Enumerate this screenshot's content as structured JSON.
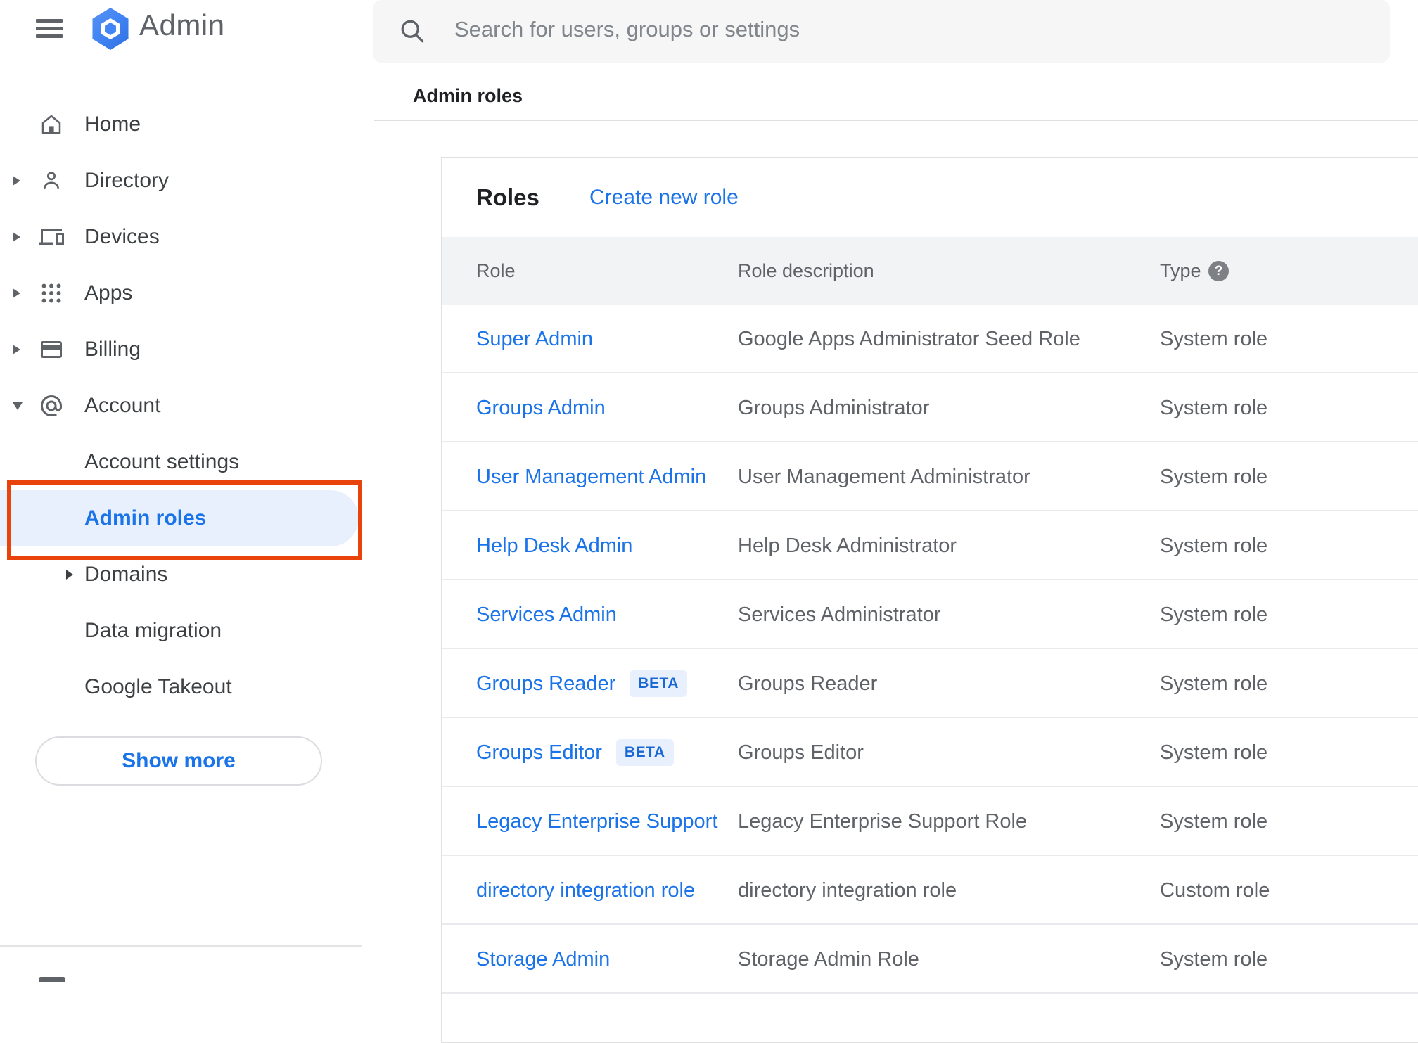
{
  "app": {
    "name": "Admin"
  },
  "header": {
    "search_placeholder": "Search for users, groups or settings"
  },
  "breadcrumb": "Admin roles",
  "sidebar": {
    "items": [
      {
        "label": "Home",
        "icon": "home",
        "expander": "none"
      },
      {
        "label": "Directory",
        "icon": "person",
        "expander": "collapsed"
      },
      {
        "label": "Devices",
        "icon": "devices",
        "expander": "collapsed"
      },
      {
        "label": "Apps",
        "icon": "apps-grid",
        "expander": "collapsed"
      },
      {
        "label": "Billing",
        "icon": "credit-card",
        "expander": "collapsed"
      },
      {
        "label": "Account",
        "icon": "at-sign",
        "expander": "expanded"
      }
    ],
    "account_subitems": [
      {
        "label": "Account settings",
        "selected": false,
        "expander": "none"
      },
      {
        "label": "Admin roles",
        "selected": true,
        "expander": "none"
      },
      {
        "label": "Domains",
        "selected": false,
        "expander": "collapsed"
      },
      {
        "label": "Data migration",
        "selected": false,
        "expander": "none"
      },
      {
        "label": "Google Takeout",
        "selected": false,
        "expander": "none"
      }
    ],
    "show_more_label": "Show more"
  },
  "main": {
    "title": "Roles",
    "create_link": "Create new role",
    "table": {
      "columns": [
        "Role",
        "Role description",
        "Type"
      ],
      "rows": [
        {
          "role": "Super Admin",
          "beta": false,
          "description": "Google Apps Administrator Seed Role",
          "type": "System role"
        },
        {
          "role": "Groups Admin",
          "beta": false,
          "description": "Groups Administrator",
          "type": "System role"
        },
        {
          "role": "User Management Admin",
          "beta": false,
          "description": "User Management Administrator",
          "type": "System role"
        },
        {
          "role": "Help Desk Admin",
          "beta": false,
          "description": "Help Desk Administrator",
          "type": "System role"
        },
        {
          "role": "Services Admin",
          "beta": false,
          "description": "Services Administrator",
          "type": "System role"
        },
        {
          "role": "Groups Reader",
          "beta": true,
          "beta_label": "BETA",
          "description": "Groups Reader",
          "type": "System role"
        },
        {
          "role": "Groups Editor",
          "beta": true,
          "beta_label": "BETA",
          "description": "Groups Editor",
          "type": "System role"
        },
        {
          "role": "Legacy Enterprise Support",
          "beta": false,
          "description": "Legacy Enterprise Support Role",
          "type": "System role"
        },
        {
          "role": "directory integration role",
          "beta": false,
          "description": "directory integration role",
          "type": "Custom role"
        },
        {
          "role": "Storage Admin",
          "beta": false,
          "description": "Storage Admin Role",
          "type": "System role"
        }
      ]
    }
  },
  "colors": {
    "accent_blue": "#1a73e8",
    "selected_item_bg": "#e8f0fe",
    "beta_badge_bg": "#e8f0fe",
    "beta_badge_text": "#1967d2",
    "annotation_red": "#e8430b",
    "table_header_bg": "#f1f3f4"
  }
}
